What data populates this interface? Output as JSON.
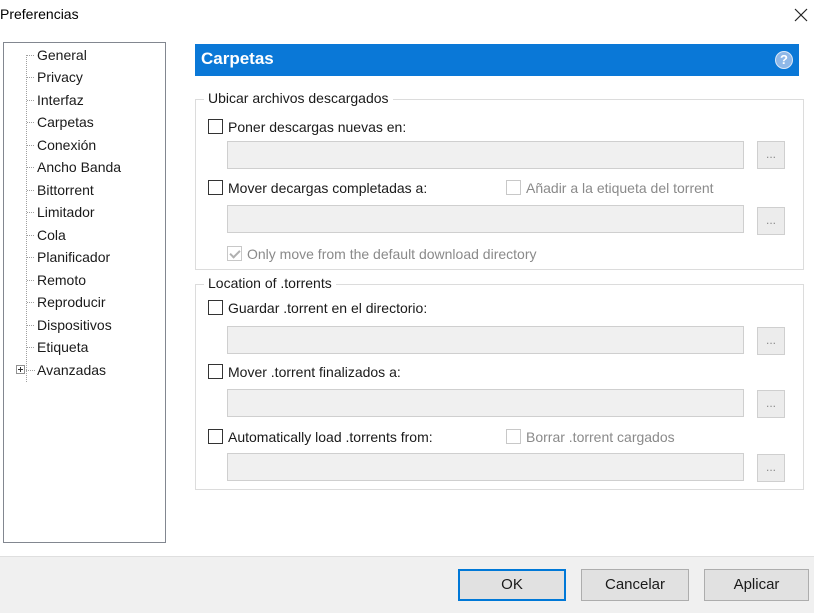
{
  "window": {
    "title": "Preferencias"
  },
  "sidebar": {
    "items": [
      {
        "label": "General"
      },
      {
        "label": "Privacy"
      },
      {
        "label": "Interfaz"
      },
      {
        "label": "Carpetas"
      },
      {
        "label": "Conexión"
      },
      {
        "label": "Ancho Banda"
      },
      {
        "label": "Bittorrent"
      },
      {
        "label": "Limitador"
      },
      {
        "label": "Cola"
      },
      {
        "label": "Planificador"
      },
      {
        "label": "Remoto"
      },
      {
        "label": "Reproducir"
      },
      {
        "label": "Dispositivos"
      },
      {
        "label": "Etiqueta"
      },
      {
        "label": "Avanzadas"
      }
    ],
    "selected": "Carpetas"
  },
  "header": {
    "title": "Carpetas",
    "help_icon": "help-icon",
    "help_glyph": "?"
  },
  "group_downloads": {
    "title": "Ubicar archivos descargados",
    "new_downloads": {
      "label": "Poner descargas nuevas en:",
      "checked": false,
      "value": ""
    },
    "move_completed": {
      "label": "Mover decargas completadas a:",
      "checked": false,
      "value": ""
    },
    "add_label": {
      "label": "Añadir a la etiqueta del torrent",
      "checked": false,
      "enabled": false
    },
    "only_move_default": {
      "label": "Only move from the default download directory",
      "checked": true,
      "enabled": false
    },
    "browse_label": "..."
  },
  "group_torrents": {
    "title": "Location of .torrents",
    "store_torrent": {
      "label": "Guardar .torrent en el directorio:",
      "checked": false,
      "value": ""
    },
    "move_finished": {
      "label": "Mover .torrent finalizados a:",
      "checked": false,
      "value": ""
    },
    "autoload": {
      "label": "Automatically load .torrents from:",
      "checked": false,
      "value": ""
    },
    "delete_loaded": {
      "label": "Borrar .torrent cargados",
      "checked": false,
      "enabled": false
    },
    "browse_label": "..."
  },
  "footer": {
    "ok_label": "OK",
    "cancel_label": "Cancelar",
    "apply_label": "Aplicar"
  },
  "colors": {
    "accent": "#0a78d7",
    "default_button_border": "#0078d7"
  }
}
